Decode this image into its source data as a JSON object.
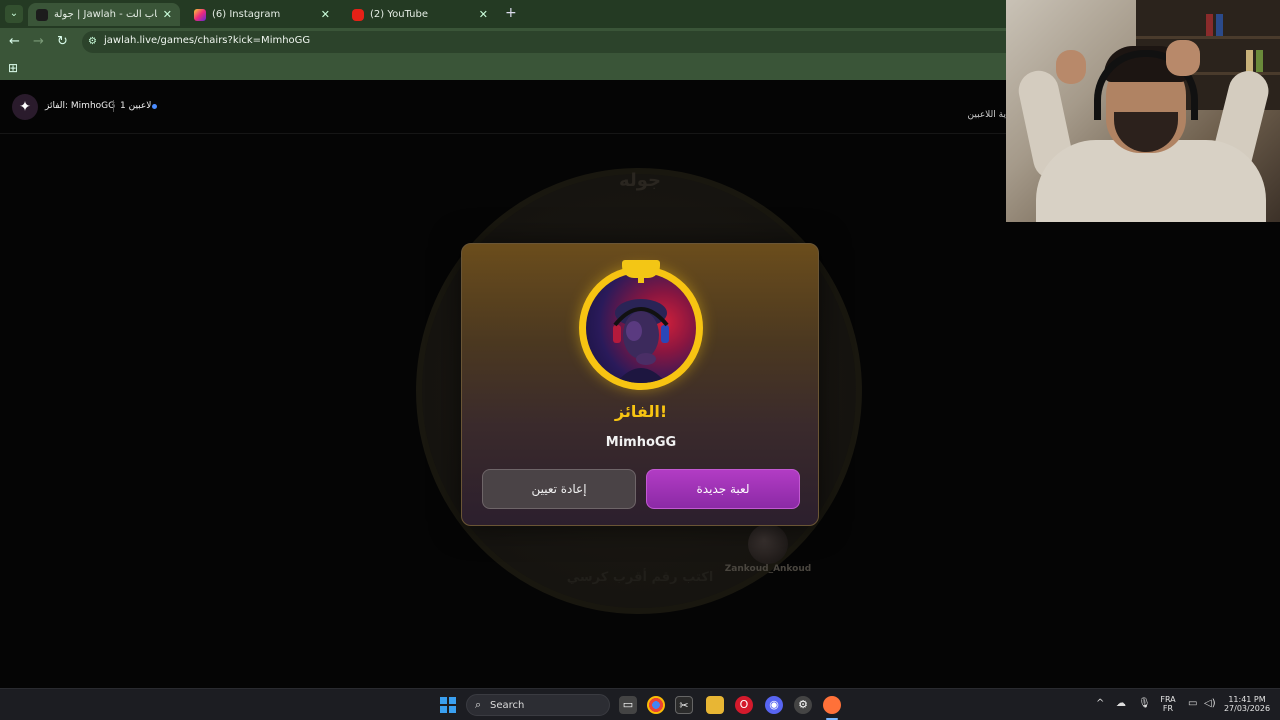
{
  "browser": {
    "tabs": [
      {
        "title": "جولة | Jawlah - منصة الألعاب الت",
        "favicon": "jawlah-icon",
        "active": true,
        "close": "✕"
      },
      {
        "title": "(6) Instagram",
        "favicon": "instagram-icon",
        "active": false,
        "close": "✕"
      },
      {
        "title": "(2) YouTube",
        "favicon": "youtube-icon",
        "active": false,
        "close": "✕"
      }
    ],
    "new_tab": "+",
    "tab_list": "⌄",
    "url": "jawlah.live/games/chairs?kick=MimhoGG",
    "nav": {
      "back": "←",
      "forward": "→",
      "reload": "↻"
    }
  },
  "site_header": {
    "winner_label": "الفائز: MimhoGG",
    "players_count": "1 لاعبين",
    "players_tab": "ية اللاعبين",
    "logo_char": "✦"
  },
  "game": {
    "title": "جوله",
    "hint": "اكتب رقم أقرب كرسي",
    "player_name": "Zankoud_Ankoud"
  },
  "modal": {
    "heading": "الفائز!",
    "winner_name": "MimhoGG",
    "reset_button": "إعادة تعيين",
    "new_game_button": "لعبة جديدة"
  },
  "taskbar": {
    "search_label": "Search",
    "lang_top": "FRA",
    "lang_bottom": "FR",
    "time": "11:41 PM",
    "date": "27/03/2026"
  },
  "colors": {
    "accent_gold": "#f7c412",
    "accent_purple": "#9b31b5",
    "browser_green": "#3a5538"
  }
}
